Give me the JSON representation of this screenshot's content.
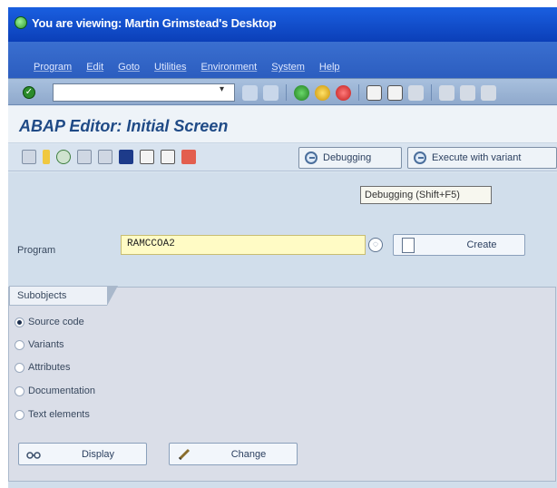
{
  "window": {
    "title": "You are viewing: Martin Grimstead's Desktop"
  },
  "menu": {
    "items": [
      "Program",
      "Edit",
      "Goto",
      "Utilities",
      "Environment",
      "System",
      "Help"
    ]
  },
  "toolbar": {
    "command_value": ""
  },
  "page": {
    "title": "ABAP Editor: Initial Screen"
  },
  "app_toolbar": {
    "debugging_label": "Debugging",
    "execute_variant_label": "Execute with variant"
  },
  "tooltip": {
    "text": "Debugging (Shift+F5)"
  },
  "program": {
    "label": "Program",
    "value": "RAMCCOA2",
    "create_label": "Create"
  },
  "subobjects": {
    "title": "Subobjects",
    "options": [
      {
        "label": "Source code",
        "selected": true
      },
      {
        "label": "Variants",
        "selected": false
      },
      {
        "label": "Attributes",
        "selected": false
      },
      {
        "label": "Documentation",
        "selected": false
      },
      {
        "label": "Text elements",
        "selected": false
      }
    ]
  },
  "actions": {
    "display_label": "Display",
    "change_label": "Change"
  },
  "colors": {
    "title_bar": "#0b3fb8",
    "page_title": "#1f4a86",
    "input_highlight": "#fffbc5"
  }
}
